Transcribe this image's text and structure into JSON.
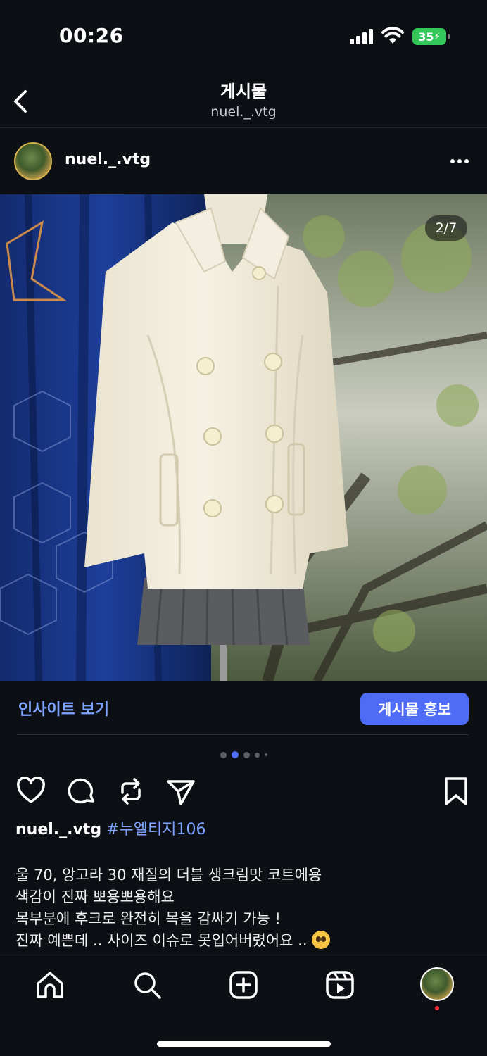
{
  "status_bar": {
    "time": "00:26",
    "battery": "35"
  },
  "header": {
    "title": "게시물",
    "subtitle": "nuel._.vtg"
  },
  "author": {
    "username": "nuel._.vtg"
  },
  "post_image": {
    "counter": "2/7",
    "description_icon": "cream-double-breasted-coat-photo"
  },
  "insights": {
    "link_label": "인사이트 보기",
    "promote_label": "게시물 홍보"
  },
  "carousel": {
    "active_index": 1,
    "dot_count": 5
  },
  "caption": {
    "username": "nuel._.vtg",
    "hashtag": "#누엘티지106",
    "lines": [
      "울 70, 앙고라 30 재질의 더블 생크림맛 코트에용",
      "색감이 진짜 뽀용뽀용해요",
      "목부분에 후크로 완전히 목을 감싸기 가능 !",
      "진짜 예쁜데 .. 사이즈 이슈로 못입어버렸어요 .."
    ],
    "emoji_icon": "pleading-face-emoji"
  },
  "colors": {
    "accent": "#4f6cf7",
    "link": "#7ea3ff",
    "background": "#0c0f14",
    "battery": "#34c759"
  }
}
